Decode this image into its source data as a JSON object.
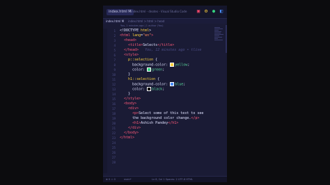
{
  "window": {
    "title": "index.html - dnotes - Visual Studio Code",
    "tab_label": "index.html M",
    "breadcrumb": "index.html > html > head",
    "blame": "You, 1 minutes ago | 1 author (You)",
    "ghost_hint": "You, 12 minutes ago • tlive"
  },
  "titlebar_icons": [
    {
      "name": "layout-icon",
      "color": "#ff4b6e"
    },
    {
      "name": "settings-icon",
      "color": "#ffd23c"
    },
    {
      "name": "account-icon",
      "color": "#35d27f"
    },
    {
      "name": "window-icon",
      "color": "#4a90ff"
    }
  ],
  "code_lines": [
    {
      "n": "1",
      "tokens": [
        [
          "p",
          "<!DOCTYPE "
        ],
        [
          "a",
          "html"
        ],
        [
          "p",
          ">"
        ]
      ]
    },
    {
      "n": "2",
      "tokens": [
        [
          "t",
          "<html"
        ],
        [
          "a",
          " lang"
        ],
        [
          "p",
          "="
        ],
        [
          "s",
          "\"en\""
        ],
        [
          "t",
          ">"
        ]
      ]
    },
    {
      "n": "3",
      "tokens": [
        [
          "p",
          "  "
        ],
        [
          "t",
          "<head>"
        ]
      ]
    },
    {
      "n": "4",
      "tokens": [
        [
          "p",
          "    "
        ],
        [
          "t",
          "<title>"
        ],
        [
          "p",
          "Selects"
        ],
        [
          "t",
          "</title>"
        ]
      ]
    },
    {
      "n": "5",
      "tokens": [
        [
          "p",
          "  "
        ],
        [
          "t",
          "</head>"
        ]
      ]
    },
    {
      "n": "6",
      "tokens": [
        [
          "p",
          "  "
        ],
        [
          "t",
          "<style>"
        ]
      ]
    },
    {
      "n": "7",
      "tokens": [
        [
          "p",
          "    "
        ],
        [
          "a",
          "p::selection"
        ],
        [
          "p",
          " {"
        ]
      ]
    },
    {
      "n": "8",
      "tokens": [
        [
          "p",
          "      background-color: "
        ],
        [
          "sw",
          "#ffd23c"
        ],
        [
          "v",
          "yellow"
        ],
        [
          "p",
          ";"
        ]
      ]
    },
    {
      "n": "9",
      "tokens": [
        [
          "p",
          "      color: "
        ],
        [
          "sw",
          "#35d27f"
        ],
        [
          "v",
          "green"
        ],
        [
          "p",
          ";"
        ]
      ]
    },
    {
      "n": "10",
      "tokens": [
        [
          "p",
          "    }"
        ]
      ]
    },
    {
      "n": "11",
      "tokens": [
        [
          "p",
          "    "
        ],
        [
          "a",
          "h1::selection"
        ],
        [
          "p",
          " {"
        ]
      ]
    },
    {
      "n": "12",
      "tokens": [
        [
          "p",
          "      background-color: "
        ],
        [
          "sw",
          "#4a90ff"
        ],
        [
          "v",
          "blue"
        ],
        [
          "p",
          ";"
        ]
      ]
    },
    {
      "n": "13",
      "tokens": [
        [
          "p",
          "      color: "
        ],
        [
          "sw",
          "#000000"
        ],
        [
          "v",
          "black"
        ],
        [
          "p",
          ";"
        ]
      ]
    },
    {
      "n": "14",
      "tokens": [
        [
          "p",
          "    }"
        ]
      ]
    },
    {
      "n": "15",
      "tokens": [
        [
          "p",
          "  "
        ],
        [
          "t",
          "</style>"
        ]
      ]
    },
    {
      "n": "16",
      "tokens": [
        [
          "p",
          "  "
        ],
        [
          "t",
          "<body>"
        ]
      ]
    },
    {
      "n": "17",
      "tokens": [
        [
          "p",
          "    "
        ],
        [
          "t",
          "<div>"
        ]
      ]
    },
    {
      "n": "18",
      "tokens": [
        [
          "p",
          "      "
        ],
        [
          "t",
          "<p>"
        ],
        [
          "p",
          "Select some of this text to see"
        ]
      ]
    },
    {
      "n": "19",
      "tokens": [
        [
          "p",
          "      the background color change."
        ],
        [
          "t",
          "</p>"
        ]
      ]
    },
    {
      "n": "20",
      "tokens": [
        [
          "p",
          "      "
        ],
        [
          "t",
          "<h1>"
        ],
        [
          "p",
          "Ashish Pandey"
        ],
        [
          "t",
          "</h1>"
        ]
      ]
    },
    {
      "n": "21",
      "tokens": [
        [
          "p",
          "    "
        ],
        [
          "t",
          "</div>"
        ]
      ]
    },
    {
      "n": "22",
      "tokens": [
        [
          "p",
          "  "
        ],
        [
          "t",
          "</body>"
        ]
      ]
    },
    {
      "n": "23",
      "tokens": [
        [
          "t",
          "</html>"
        ]
      ]
    },
    {
      "n": "24",
      "tokens": []
    },
    {
      "n": "25",
      "tokens": []
    },
    {
      "n": "26",
      "tokens": []
    },
    {
      "n": "27",
      "tokens": []
    },
    {
      "n": "28",
      "tokens": []
    }
  ],
  "status": {
    "left": "⊗ 0 ⚠ 0",
    "branch": "main*",
    "right": "Ln 8, Col 1   Spaces: 2   UTF-8   HTML"
  }
}
